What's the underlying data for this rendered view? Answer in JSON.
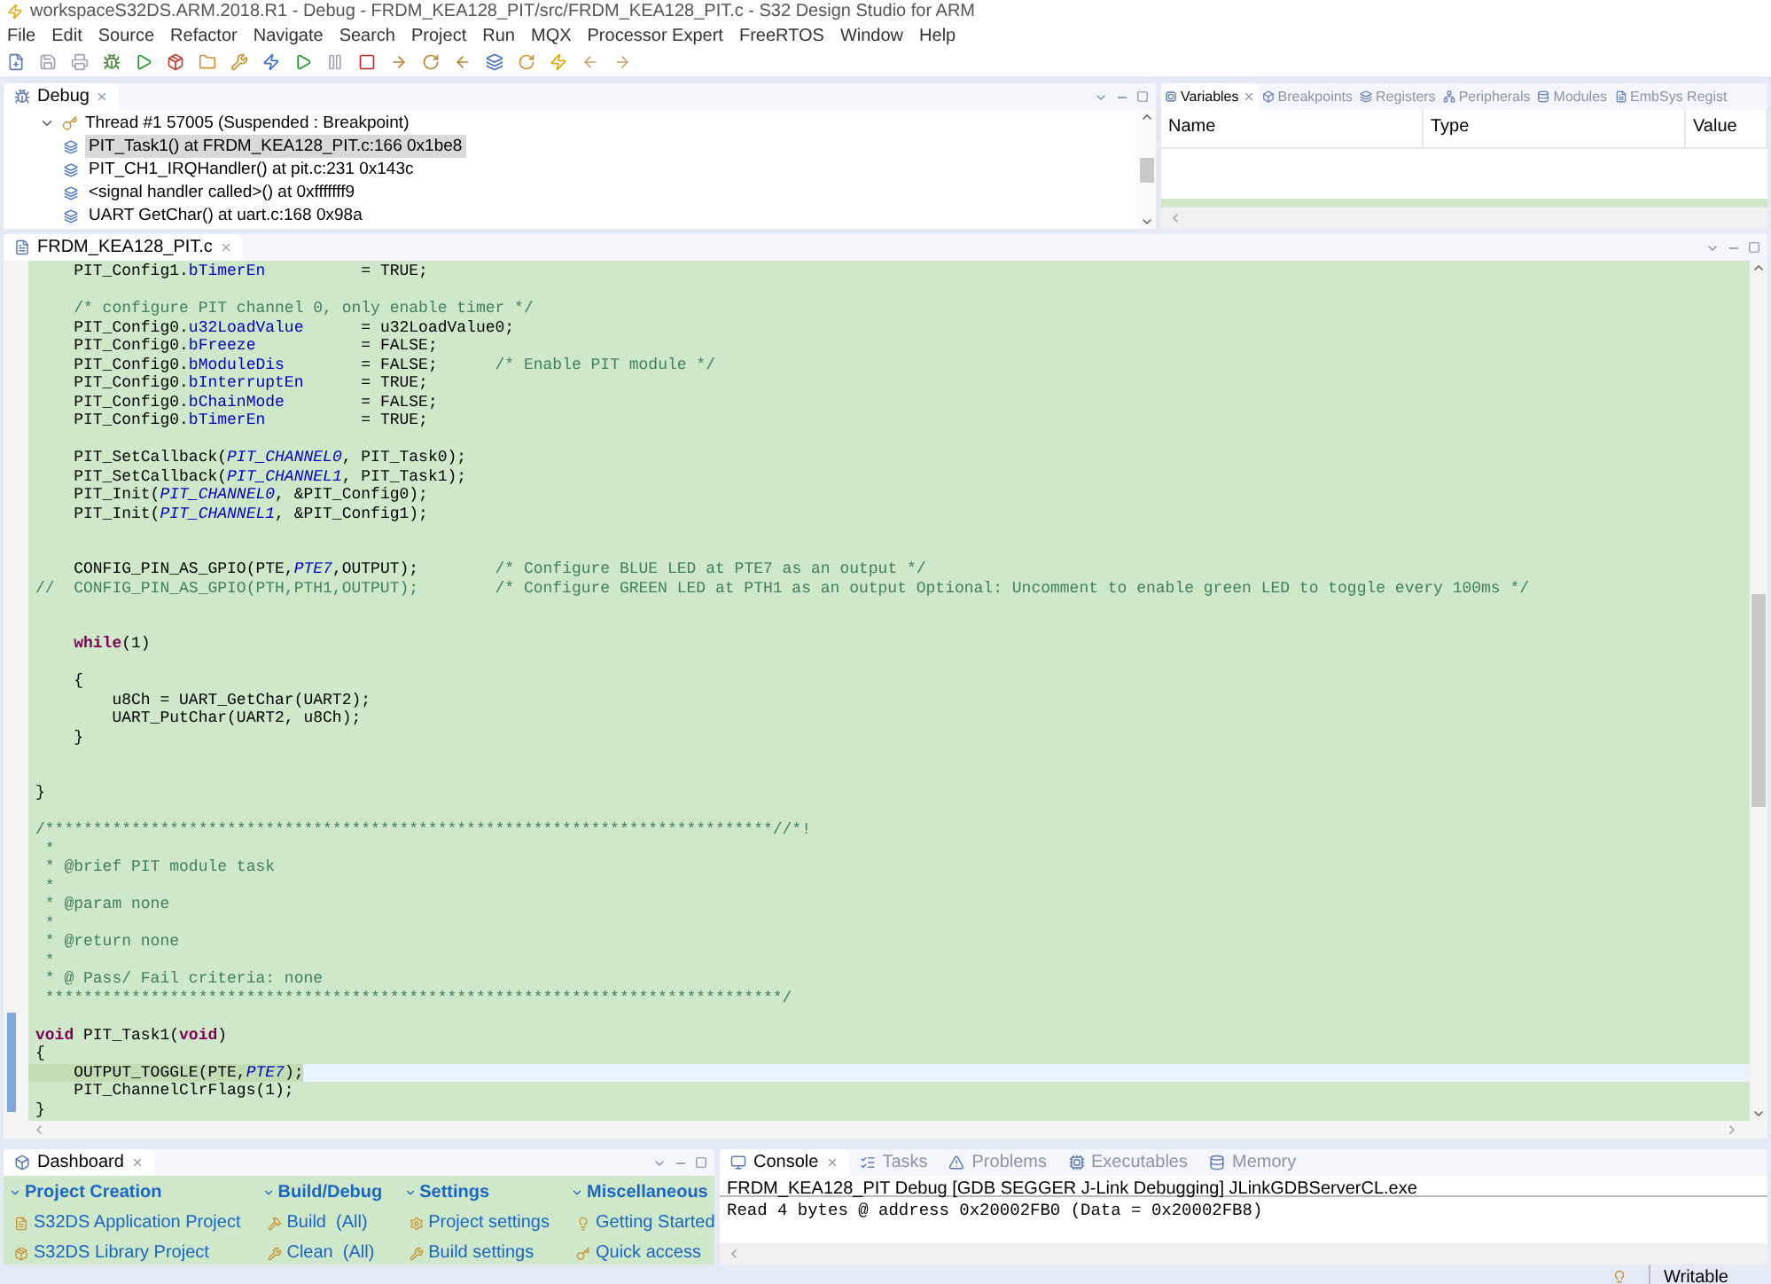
{
  "window": {
    "title": "workspaceS32DS.ARM.2018.R1 - Debug - FRDM_KEA128_PIT/src/FRDM_KEA128_PIT.c - S32 Design Studio for ARM"
  },
  "menu": [
    "File",
    "Edit",
    "Source",
    "Refactor",
    "Navigate",
    "Search",
    "Project",
    "Run",
    "MQX",
    "Processor Expert",
    "FreeRTOS",
    "Window",
    "Help"
  ],
  "debug_view": {
    "tab": "Debug",
    "thread": {
      "label": "Thread #1 57005 (Suspended : Breakpoint)",
      "expanded": true
    },
    "frames": [
      {
        "label": "PIT_Task1() at FRDM_KEA128_PIT.c:166 0x1be8",
        "selected": true
      },
      {
        "label": "PIT_CH1_IRQHandler() at pit.c:231 0x143c",
        "selected": false
      },
      {
        "label": "<signal handler called>() at 0xfffffff9",
        "selected": false
      },
      {
        "label": "UART GetChar() at uart.c:168 0x98a",
        "selected": false
      }
    ]
  },
  "variables_view": {
    "tabs": [
      {
        "label": "Variables",
        "selected": true
      },
      {
        "label": "Breakpoints",
        "selected": false
      },
      {
        "label": "Registers",
        "selected": false
      },
      {
        "label": "Peripherals",
        "selected": false
      },
      {
        "label": "Modules",
        "selected": false
      },
      {
        "label": "EmbSys Regist",
        "selected": false
      }
    ],
    "columns": [
      "Name",
      "Type",
      "Value"
    ]
  },
  "editor": {
    "tab": "FRDM_KEA128_PIT.c",
    "lines": [
      {
        "kind": "code",
        "current": false,
        "segments": [
          {
            "kind": "text",
            "text": "    PIT_Config1."
          },
          {
            "kind": "field",
            "text": "bTimerEn"
          },
          {
            "kind": "text",
            "text": "          = TRUE;"
          }
        ]
      },
      {
        "kind": "blank"
      },
      {
        "kind": "code",
        "current": false,
        "segments": [
          {
            "kind": "comment",
            "text": "    /* configure PIT channel 0, only enable timer */"
          }
        ]
      },
      {
        "kind": "code",
        "current": false,
        "segments": [
          {
            "kind": "text",
            "text": "    PIT_Config0."
          },
          {
            "kind": "field",
            "text": "u32LoadValue"
          },
          {
            "kind": "text",
            "text": "      = u32LoadValue0;"
          }
        ]
      },
      {
        "kind": "code",
        "current": false,
        "segments": [
          {
            "kind": "text",
            "text": "    PIT_Config0."
          },
          {
            "kind": "field",
            "text": "bFreeze"
          },
          {
            "kind": "text",
            "text": "           = FALSE;"
          }
        ]
      },
      {
        "kind": "code",
        "current": false,
        "segments": [
          {
            "kind": "text",
            "text": "    PIT_Config0."
          },
          {
            "kind": "field",
            "text": "bModuleDis"
          },
          {
            "kind": "text",
            "text": "        = FALSE;      "
          },
          {
            "kind": "comment",
            "text": "/* Enable PIT module */"
          }
        ]
      },
      {
        "kind": "code",
        "current": false,
        "segments": [
          {
            "kind": "text",
            "text": "    PIT_Config0."
          },
          {
            "kind": "field",
            "text": "bInterruptEn"
          },
          {
            "kind": "text",
            "text": "      = TRUE;"
          }
        ]
      },
      {
        "kind": "code",
        "current": false,
        "segments": [
          {
            "kind": "text",
            "text": "    PIT_Config0."
          },
          {
            "kind": "field",
            "text": "bChainMode"
          },
          {
            "kind": "text",
            "text": "        = FALSE;"
          }
        ]
      },
      {
        "kind": "code",
        "current": false,
        "segments": [
          {
            "kind": "text",
            "text": "    PIT_Config0."
          },
          {
            "kind": "field",
            "text": "bTimerEn"
          },
          {
            "kind": "text",
            "text": "          = TRUE;"
          }
        ]
      },
      {
        "kind": "blank"
      },
      {
        "kind": "code",
        "current": false,
        "segments": [
          {
            "kind": "text",
            "text": "    PIT_SetCallback("
          },
          {
            "kind": "const",
            "text": "PIT_CHANNEL0"
          },
          {
            "kind": "text",
            "text": ", PIT_Task0);"
          }
        ]
      },
      {
        "kind": "code",
        "current": false,
        "segments": [
          {
            "kind": "text",
            "text": "    PIT_SetCallback("
          },
          {
            "kind": "const",
            "text": "PIT_CHANNEL1"
          },
          {
            "kind": "text",
            "text": ", PIT_Task1);"
          }
        ]
      },
      {
        "kind": "code",
        "current": false,
        "segments": [
          {
            "kind": "text",
            "text": "    PIT_Init("
          },
          {
            "kind": "const",
            "text": "PIT_CHANNEL0"
          },
          {
            "kind": "text",
            "text": ", &PIT_Config0);"
          }
        ]
      },
      {
        "kind": "code",
        "current": false,
        "segments": [
          {
            "kind": "text",
            "text": "    PIT_Init("
          },
          {
            "kind": "const",
            "text": "PIT_CHANNEL1"
          },
          {
            "kind": "text",
            "text": ", &PIT_Config1);"
          }
        ]
      },
      {
        "kind": "blank"
      },
      {
        "kind": "blank"
      },
      {
        "kind": "code",
        "current": false,
        "segments": [
          {
            "kind": "text",
            "text": "    CONFIG_PIN_AS_GPIO(PTE,"
          },
          {
            "kind": "const",
            "text": "PTE7"
          },
          {
            "kind": "text",
            "text": ",OUTPUT);        "
          },
          {
            "kind": "comment",
            "text": "/* Configure BLUE LED at PTE7 as an output */"
          }
        ]
      },
      {
        "kind": "code",
        "current": false,
        "segments": [
          {
            "kind": "comment",
            "text": "//  CONFIG_PIN_AS_GPIO(PTH,PTH1,OUTPUT);        /* Configure GREEN LED at PTH1 as an output Optional: Uncomment to enable green LED to toggle every 100ms */"
          }
        ]
      },
      {
        "kind": "blank"
      },
      {
        "kind": "blank"
      },
      {
        "kind": "code",
        "current": false,
        "segments": [
          {
            "kind": "keyword",
            "text": "    while"
          },
          {
            "kind": "text",
            "text": "(1)"
          }
        ]
      },
      {
        "kind": "blank"
      },
      {
        "kind": "code",
        "current": false,
        "segments": [
          {
            "kind": "text",
            "text": "    {"
          }
        ]
      },
      {
        "kind": "code",
        "current": false,
        "segments": [
          {
            "kind": "text",
            "text": "        u8Ch = UART_GetChar(UART2);"
          }
        ]
      },
      {
        "kind": "code",
        "current": false,
        "segments": [
          {
            "kind": "text",
            "text": "        UART_PutChar(UART2, u8Ch);"
          }
        ]
      },
      {
        "kind": "code",
        "current": false,
        "segments": [
          {
            "kind": "text",
            "text": "    }"
          }
        ]
      },
      {
        "kind": "blank"
      },
      {
        "kind": "blank"
      },
      {
        "kind": "code",
        "current": false,
        "segments": [
          {
            "kind": "text",
            "text": "}"
          }
        ]
      },
      {
        "kind": "blank"
      },
      {
        "kind": "code",
        "current": false,
        "segments": [
          {
            "kind": "comment",
            "text": "/****************************************************************************//*!"
          }
        ]
      },
      {
        "kind": "code",
        "current": false,
        "segments": [
          {
            "kind": "comment",
            "text": " *"
          }
        ]
      },
      {
        "kind": "code",
        "current": false,
        "segments": [
          {
            "kind": "comment",
            "text": " * @brief PIT module task"
          }
        ]
      },
      {
        "kind": "code",
        "current": false,
        "segments": [
          {
            "kind": "comment",
            "text": " *"
          }
        ]
      },
      {
        "kind": "code",
        "current": false,
        "segments": [
          {
            "kind": "comment",
            "text": " * @param none"
          }
        ]
      },
      {
        "kind": "code",
        "current": false,
        "segments": [
          {
            "kind": "comment",
            "text": " *"
          }
        ]
      },
      {
        "kind": "code",
        "current": false,
        "segments": [
          {
            "kind": "comment",
            "text": " * @return none"
          }
        ]
      },
      {
        "kind": "code",
        "current": false,
        "segments": [
          {
            "kind": "comment",
            "text": " *"
          }
        ]
      },
      {
        "kind": "code",
        "current": false,
        "segments": [
          {
            "kind": "comment",
            "text": " * @ Pass/ Fail criteria: none"
          }
        ]
      },
      {
        "kind": "code",
        "current": false,
        "segments": [
          {
            "kind": "comment",
            "text": " *****************************************************************************/"
          }
        ]
      },
      {
        "kind": "blank"
      },
      {
        "kind": "code",
        "current": false,
        "segments": [
          {
            "kind": "keyword",
            "text": "void"
          },
          {
            "kind": "text",
            "text": " PIT_Task1("
          },
          {
            "kind": "keyword",
            "text": "void"
          },
          {
            "kind": "text",
            "text": ")"
          }
        ]
      },
      {
        "kind": "code",
        "current": false,
        "segments": [
          {
            "kind": "text",
            "text": "{"
          }
        ]
      },
      {
        "kind": "code",
        "current": true,
        "segments": [
          {
            "kind": "text",
            "text": "    OUTPUT_TOGGLE(PTE,"
          },
          {
            "kind": "const",
            "text": "PTE7"
          },
          {
            "kind": "text",
            "text": ");"
          }
        ]
      },
      {
        "kind": "code",
        "current": false,
        "segments": [
          {
            "kind": "text",
            "text": "    PIT_ChannelClrFlags(1);"
          }
        ]
      },
      {
        "kind": "code",
        "current": false,
        "segments": [
          {
            "kind": "text",
            "text": "}"
          }
        ]
      }
    ]
  },
  "dashboard": {
    "tab": "Dashboard",
    "sections": [
      {
        "title": "Project Creation",
        "items": [
          "S32DS Application Project",
          "S32DS Library Project"
        ]
      },
      {
        "title": "Build/Debug",
        "items": [
          "Build  (All)",
          "Clean  (All)"
        ]
      },
      {
        "title": "Settings",
        "items": [
          "Project settings",
          "Build settings"
        ]
      },
      {
        "title": "Miscellaneous",
        "items": [
          "Getting Started",
          "Quick access"
        ]
      }
    ]
  },
  "console": {
    "tabs": [
      {
        "label": "Console",
        "selected": true
      },
      {
        "label": "Tasks",
        "selected": false
      },
      {
        "label": "Problems",
        "selected": false
      },
      {
        "label": "Executables",
        "selected": false
      },
      {
        "label": "Memory",
        "selected": false
      }
    ],
    "header": "FRDM_KEA128_PIT Debug [GDB SEGGER J-Link Debugging] JLinkGDBServerCL.exe",
    "output": "Read 4 bytes @ address 0x20002FB0 (Data = 0x20002FB8)"
  },
  "status_bar": {
    "mode": "Writable"
  }
}
